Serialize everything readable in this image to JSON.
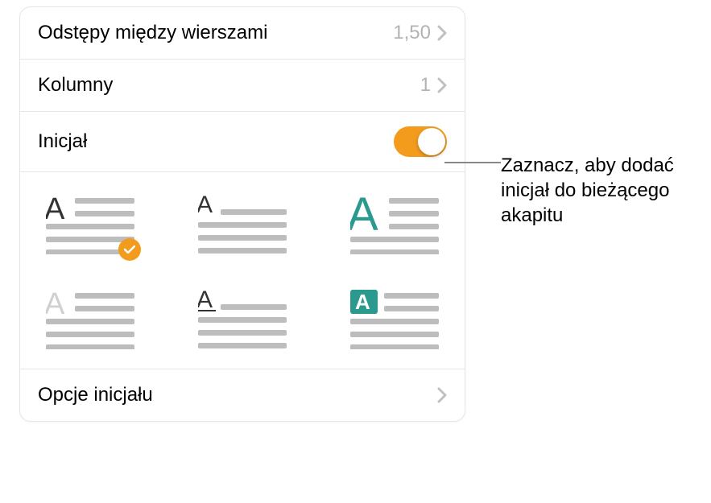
{
  "rows": {
    "line_spacing": {
      "label": "Odstępy między wierszami",
      "value": "1,50"
    },
    "columns": {
      "label": "Kolumny",
      "value": "1"
    },
    "drop_cap": {
      "label": "Inicjał",
      "enabled": true
    },
    "drop_cap_options": {
      "label": "Opcje inicjału"
    }
  },
  "styles": [
    {
      "name": "style-1-dark-small-wrap",
      "selected": true
    },
    {
      "name": "style-2-dark-small-above",
      "selected": false
    },
    {
      "name": "style-3-teal-large-wrap",
      "selected": false
    },
    {
      "name": "style-4-light-gray",
      "selected": false
    },
    {
      "name": "style-5-dark-underline",
      "selected": false
    },
    {
      "name": "style-6-teal-boxed",
      "selected": false
    }
  ],
  "annotation": "Zaznacz, aby dodać inicjał do bieżącego akapitu",
  "colors": {
    "accent": "#f29b1d",
    "teal": "#2a9a8f"
  }
}
